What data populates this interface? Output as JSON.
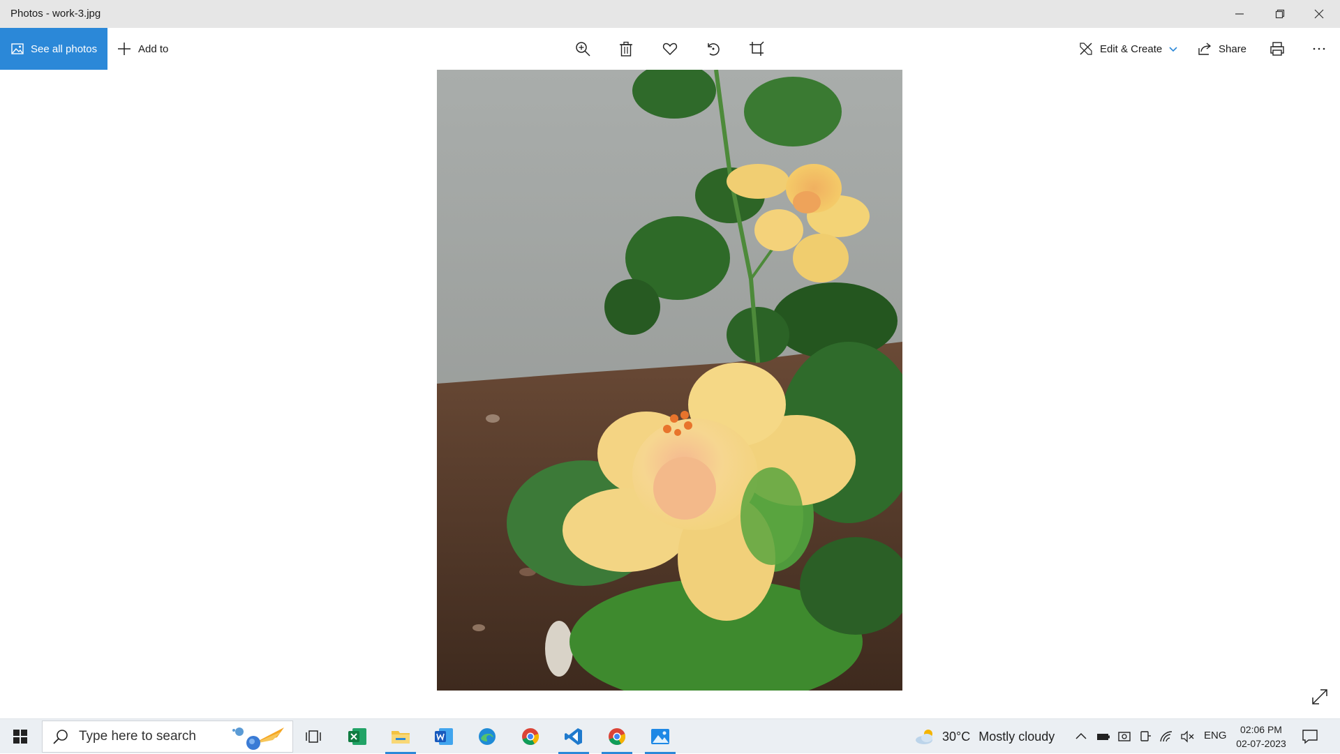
{
  "window": {
    "title": "Photos - work-3.jpg",
    "controls": [
      "minimize-icon",
      "restore-icon",
      "close-icon"
    ]
  },
  "toolbar": {
    "see_all_label": "See all photos",
    "add_to_label": "Add to",
    "center_icons": [
      "zoom-in-icon",
      "delete-icon",
      "favorite-heart-icon",
      "rotate-icon",
      "crop-icon"
    ],
    "edit_create_label": "Edit & Create",
    "share_label": "Share",
    "right_icons": [
      "print-icon",
      "more-options-icon"
    ],
    "accent_color": "#2b88d8"
  },
  "photo": {
    "subject": "yellow-hibiscus-flowers"
  },
  "taskbar": {
    "search_placeholder": "Type here to search",
    "apps": [
      "task-view-icon",
      "excel-icon",
      "file-explorer-icon",
      "word-icon",
      "edge-icon",
      "chrome-icon",
      "vscode-icon",
      "chrome-icon",
      "photos-icon"
    ],
    "weather_temp": "30°C",
    "weather_condition": "Mostly cloudy",
    "language": "ENG",
    "time": "02:06 PM",
    "date": "02-07-2023"
  }
}
